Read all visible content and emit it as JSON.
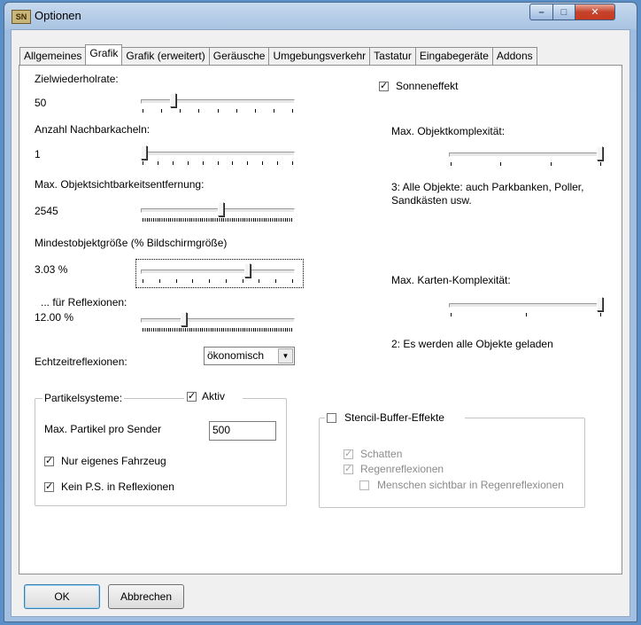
{
  "window": {
    "title": "Optionen",
    "icon_text": "SN"
  },
  "tabs": [
    {
      "label": "Allgemeines"
    },
    {
      "label": "Grafik"
    },
    {
      "label": "Grafik (erweitert)"
    },
    {
      "label": "Geräusche"
    },
    {
      "label": "Umgebungsverkehr"
    },
    {
      "label": "Tastatur"
    },
    {
      "label": "Eingabegeräte"
    },
    {
      "label": "Addons"
    }
  ],
  "active_tab": "Grafik",
  "left": {
    "frame_rate": {
      "label": "Zielwiederholrate:",
      "value": "50",
      "level": 0.2
    },
    "neighbor_tiles": {
      "label": "Anzahl Nachbarkacheln:",
      "value": "1",
      "level": 0.0
    },
    "object_distance": {
      "label": "Max. Objektsichtbarkeitsentfernung:",
      "value": "2545",
      "level": 0.52
    },
    "min_object_size": {
      "label": "Mindestobjektgröße (% Bildschirmgröße)",
      "value": "3.03 %",
      "level": 0.7
    },
    "reflections": {
      "label": "... für Reflexionen:",
      "value": "12.00 %",
      "level": 0.27
    },
    "realtime_reflections": {
      "label": "Echtzeitreflexionen:",
      "value": "ökonomisch"
    }
  },
  "particles": {
    "group_label": "Partikelsysteme:",
    "active_label": "Aktiv",
    "active": true,
    "max_label": "Max. Partikel pro Sender",
    "max_value": "500",
    "own_vehicle_label": "Nur eigenes Fahrzeug",
    "own_vehicle": true,
    "no_reflections_label": "Kein P.S. in Reflexionen",
    "no_reflections": true
  },
  "right": {
    "sun_effect_label": "Sonneneffekt",
    "sun_effect": true,
    "object_complexity": {
      "label": "Max. Objektkomplexität:",
      "level": 1.0,
      "description": "3: Alle Objekte: auch Parkbanken, Poller, Sandkästen usw."
    },
    "map_complexity": {
      "label": "Max. Karten-Komplexität:",
      "level": 1.0,
      "description": "2: Es werden alle Objekte geladen"
    }
  },
  "stencil": {
    "label": "Stencil-Buffer-Effekte",
    "enabled": false,
    "shadows_label": "Schatten",
    "rain_label": "Regenreflexionen",
    "people_label": "Menschen sichtbar in Regenreflexionen"
  },
  "buttons": {
    "ok": "OK",
    "cancel": "Abbrechen"
  }
}
